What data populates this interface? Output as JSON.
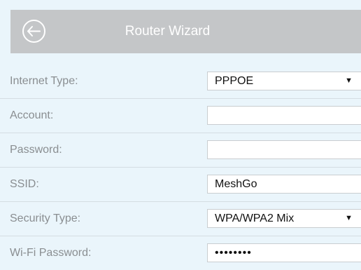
{
  "header": {
    "title": "Router Wizard",
    "back_icon": "back-arrow-circle-icon"
  },
  "form": {
    "internet_type": {
      "label": "Internet Type:",
      "value": "PPPOE"
    },
    "account": {
      "label": "Account:",
      "value": ""
    },
    "password": {
      "label": "Password:",
      "value": ""
    },
    "ssid": {
      "label": "SSID:",
      "value": "MeshGo"
    },
    "security_type": {
      "label": "Security Type:",
      "value": "WPA/WPA2 Mix"
    },
    "wifi_password": {
      "label": "Wi-Fi Password:",
      "masked_value": "••••••••"
    }
  },
  "colors": {
    "background": "#eaf5fb",
    "header": "#c4c6c8",
    "label_text": "#8a8e91",
    "divider": "#d4dde2"
  }
}
